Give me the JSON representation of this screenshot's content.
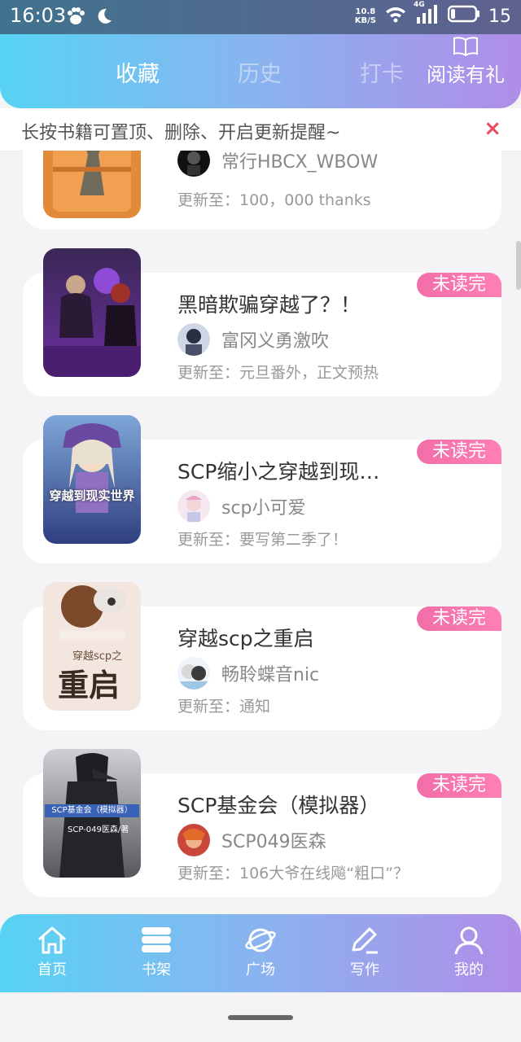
{
  "status_bar": {
    "time": "16:03",
    "speed_top": "10.8",
    "speed_bottom": "KB/S",
    "net": "4G",
    "battery": "15"
  },
  "header": {
    "tabs": [
      {
        "label": "收藏"
      },
      {
        "label": "历史"
      },
      {
        "label": "打卡"
      }
    ],
    "reward_label": "阅读有礼"
  },
  "notice": {
    "text": "长按书籍可置顶、删除、开启更新提醒~",
    "close": "×"
  },
  "books": [
    {
      "title": "",
      "author": "常行HBCX_WBOW",
      "update": "更新至：100，000 thanks",
      "badge": ""
    },
    {
      "title": "黑暗欺骗穿越了？！",
      "author": "富冈义勇激吹",
      "update": "更新至：元旦番外，正文预热",
      "badge": "未读完"
    },
    {
      "title": "SCP缩小之穿越到现…",
      "author": "scp小可爱",
      "update": "更新至：要写第二季了！",
      "badge": "未读完",
      "cover_text": "穿越到现实世界"
    },
    {
      "title": "穿越scp之重启",
      "author": "畅聆蝶音nic",
      "update": "更新至：通知",
      "badge": "未读完",
      "cover_text": "重启",
      "cover_sub": "穿越scp之"
    },
    {
      "title": "SCP基金会（模拟器）",
      "author": "SCP049医森",
      "update": "更新至：106大爷在线飚“粗口”？",
      "badge": "未读完",
      "cover_text": "SCP基金会（模拟器）",
      "cover_sub": "SCP-049医森/著"
    }
  ],
  "bottom_nav": [
    {
      "label": "首页",
      "icon": "home-icon"
    },
    {
      "label": "书架",
      "icon": "bookshelf-icon"
    },
    {
      "label": "广场",
      "icon": "planet-icon"
    },
    {
      "label": "写作",
      "icon": "pen-icon"
    },
    {
      "label": "我的",
      "icon": "user-icon"
    }
  ]
}
